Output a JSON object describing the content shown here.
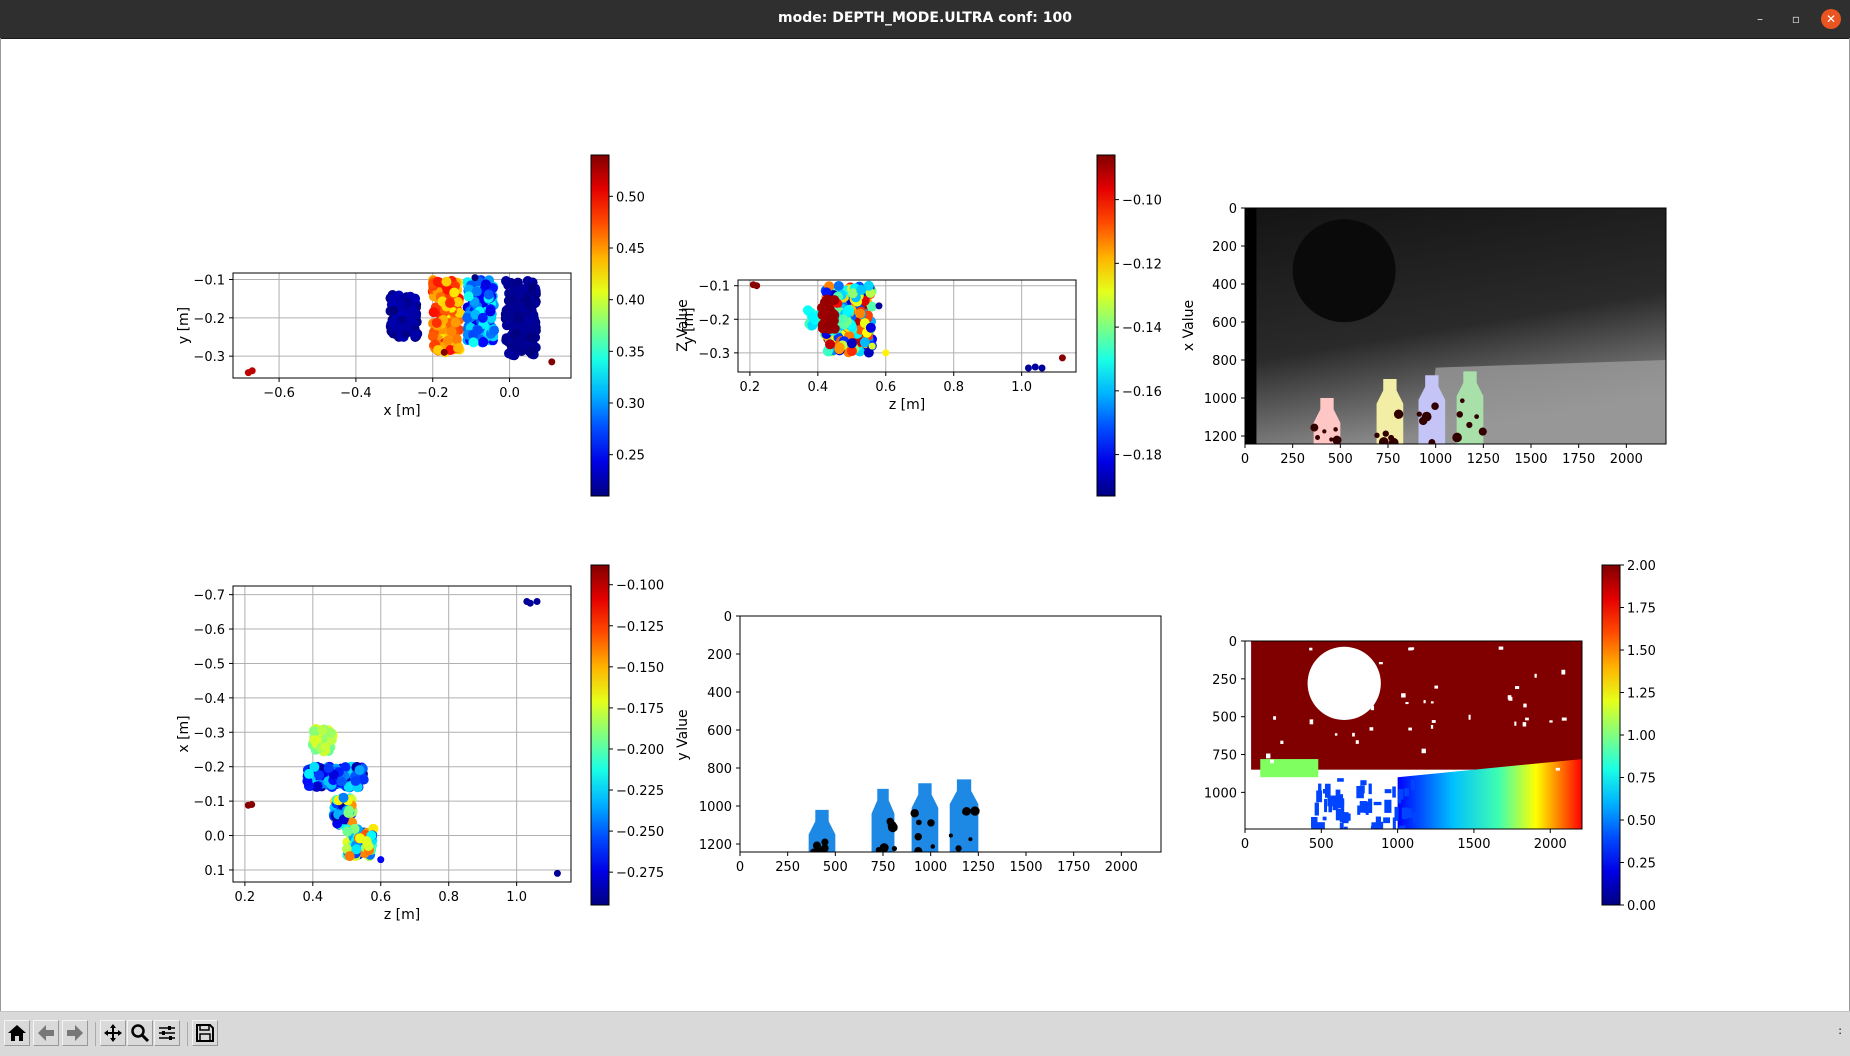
{
  "window": {
    "title": "mode: DEPTH_MODE.ULTRA conf: 100",
    "minimize": "–",
    "maximize": "▫",
    "close": "✕"
  },
  "toolbar": {
    "buttons": [
      {
        "name": "home",
        "icon": "home-icon"
      },
      {
        "name": "back",
        "icon": "arrow-left-icon"
      },
      {
        "name": "forward",
        "icon": "arrow-right-icon"
      },
      {
        "name": "pan",
        "icon": "move-icon"
      },
      {
        "name": "zoom",
        "icon": "magnifier-icon"
      },
      {
        "name": "configure-subplots",
        "icon": "sliders-icon"
      },
      {
        "name": "save",
        "icon": "floppy-icon"
      }
    ],
    "coords": ":"
  },
  "chart_data": [
    {
      "id": "p1",
      "type": "scatter",
      "xlabel": "x [m]",
      "ylabel": "y [m]",
      "cbar_label": "Z Value",
      "xlim": [
        -0.72,
        0.16
      ],
      "ylim": [
        -0.357,
        -0.083
      ],
      "xticks": [
        -0.6,
        -0.4,
        -0.2,
        0.0
      ],
      "xtick_labels": [
        "−0.6",
        "−0.4",
        "−0.2",
        "0.0"
      ],
      "yticks": [
        -0.1,
        -0.2,
        -0.3
      ],
      "ytick_labels": [
        "−0.1",
        "−0.2",
        "−0.3"
      ],
      "clim": [
        0.21,
        0.54
      ],
      "cticks": [
        0.25,
        0.3,
        0.35,
        0.4,
        0.45,
        0.5
      ],
      "ctick_labels": [
        "0.25",
        "0.30",
        "0.35",
        "0.40",
        "0.45",
        "0.50"
      ],
      "clusters": [
        {
          "x": [
            -0.31,
            -0.24
          ],
          "y": [
            -0.25,
            -0.14
          ],
          "c": [
            0.21,
            0.23
          ],
          "n": 120
        },
        {
          "x": [
            -0.2,
            -0.13
          ],
          "y": [
            -0.29,
            -0.1
          ],
          "c": [
            0.42,
            0.5
          ],
          "n": 160
        },
        {
          "x": [
            -0.11,
            -0.04
          ],
          "y": [
            -0.265,
            -0.1
          ],
          "c": [
            0.24,
            0.34
          ],
          "n": 160
        },
        {
          "x": [
            -0.01,
            0.07
          ],
          "y": [
            -0.3,
            -0.1
          ],
          "c": [
            0.21,
            0.22
          ],
          "n": 160
        }
      ],
      "points": [
        [
          -0.68,
          -0.343,
          0.52
        ],
        [
          -0.67,
          -0.338,
          0.52
        ],
        [
          0.11,
          -0.315,
          0.54
        ],
        [
          -0.09,
          -0.095,
          0.21
        ],
        [
          -0.17,
          -0.29,
          0.54
        ]
      ]
    },
    {
      "id": "p2",
      "type": "scatter",
      "xlabel": "z [m]",
      "ylabel": "y [m]",
      "cbar_label": "x Value",
      "xlim": [
        0.165,
        1.16
      ],
      "ylim": [
        -0.357,
        -0.083
      ],
      "xticks": [
        0.2,
        0.4,
        0.6,
        0.8,
        1.0
      ],
      "xtick_labels": [
        "0.2",
        "0.4",
        "0.6",
        "0.8",
        "1.0"
      ],
      "yticks": [
        -0.1,
        -0.2,
        -0.3
      ],
      "ytick_labels": [
        "−0.1",
        "−0.2",
        "−0.3"
      ],
      "clim": [
        -0.193,
        -0.086
      ],
      "cticks": [
        -0.18,
        -0.16,
        -0.14,
        -0.12,
        -0.1
      ],
      "ctick_labels": [
        "−0.18",
        "−0.16",
        "−0.14",
        "−0.12",
        "−0.10"
      ],
      "clusters": [
        {
          "x": [
            0.42,
            0.56
          ],
          "y": [
            -0.3,
            -0.1
          ],
          "c": [
            -0.19,
            -0.09
          ],
          "n": 260
        },
        {
          "x": [
            0.37,
            0.5
          ],
          "y": [
            -0.22,
            -0.17
          ],
          "c": [
            -0.16,
            -0.14
          ],
          "n": 60
        },
        {
          "x": [
            0.41,
            0.45
          ],
          "y": [
            -0.23,
            -0.14
          ],
          "c": [
            -0.09,
            -0.088
          ],
          "n": 40
        }
      ],
      "points": [
        [
          0.21,
          -0.097,
          -0.087
        ],
        [
          0.22,
          -0.1,
          -0.087
        ],
        [
          1.02,
          -0.345,
          -0.19
        ],
        [
          1.04,
          -0.342,
          -0.19
        ],
        [
          1.06,
          -0.345,
          -0.19
        ],
        [
          1.12,
          -0.315,
          -0.087
        ],
        [
          0.58,
          -0.16,
          -0.19
        ],
        [
          0.6,
          -0.3,
          -0.125
        ],
        [
          0.56,
          -0.28,
          -0.13
        ]
      ]
    },
    {
      "id": "p3",
      "type": "image",
      "xlim": [
        0,
        2208
      ],
      "ylim": [
        1242,
        0
      ],
      "xticks": [
        0,
        250,
        500,
        750,
        1000,
        1250,
        1500,
        1750,
        2000
      ],
      "xtick_labels": [
        "0",
        "250",
        "500",
        "750",
        "1000",
        "1250",
        "1500",
        "1750",
        "2000"
      ],
      "yticks": [
        0,
        200,
        400,
        600,
        800,
        1000,
        1200
      ],
      "ytick_labels": [
        "0",
        "200",
        "400",
        "600",
        "800",
        "1000",
        "1200"
      ],
      "objects": [
        {
          "x": [
            360,
            500
          ],
          "top": 1000,
          "color": "#ffc6c6"
        },
        {
          "x": [
            690,
            830
          ],
          "top": 900,
          "color": "#f2eea6"
        },
        {
          "x": [
            910,
            1050
          ],
          "top": 880,
          "color": "#c4c4f6"
        },
        {
          "x": [
            1110,
            1250
          ],
          "top": 860,
          "color": "#a9e0a9"
        }
      ]
    },
    {
      "id": "p4",
      "type": "scatter",
      "xlabel": "z [m]",
      "ylabel": "x [m]",
      "cbar_label": "y Value",
      "xlim": [
        0.165,
        1.16
      ],
      "ylim": [
        0.135,
        -0.725
      ],
      "xticks": [
        0.2,
        0.4,
        0.6,
        0.8,
        1.0
      ],
      "xtick_labels": [
        "0.2",
        "0.4",
        "0.6",
        "0.8",
        "1.0"
      ],
      "yticks": [
        -0.7,
        -0.6,
        -0.5,
        -0.4,
        -0.3,
        -0.2,
        -0.1,
        0.0,
        0.1
      ],
      "ytick_labels": [
        "−0.7",
        "−0.6",
        "−0.5",
        "−0.4",
        "−0.3",
        "−0.2",
        "−0.1",
        "0.0",
        "0.1"
      ],
      "clim": [
        -0.295,
        -0.088
      ],
      "cticks": [
        -0.275,
        -0.25,
        -0.225,
        -0.2,
        -0.175,
        -0.15,
        -0.125,
        -0.1
      ],
      "ctick_labels": [
        "−0.275",
        "−0.250",
        "−0.225",
        "−0.200",
        "−0.175",
        "−0.150",
        "−0.125",
        "−0.100"
      ],
      "clusters": [
        {
          "x": [
            0.4,
            0.46
          ],
          "y": [
            -0.31,
            -0.24
          ],
          "c": [
            -0.2,
            -0.17
          ],
          "n": 60
        },
        {
          "x": [
            0.38,
            0.55
          ],
          "y": [
            -0.2,
            -0.14
          ],
          "c": [
            -0.29,
            -0.22
          ],
          "n": 120
        },
        {
          "x": [
            0.46,
            0.52
          ],
          "y": [
            -0.11,
            -0.03
          ],
          "c": [
            -0.29,
            -0.14
          ],
          "n": 70
        },
        {
          "x": [
            0.5,
            0.58
          ],
          "y": [
            -0.02,
            0.06
          ],
          "c": [
            -0.27,
            -0.13
          ],
          "n": 80
        }
      ],
      "points": [
        [
          0.22,
          -0.09,
          -0.09
        ],
        [
          0.21,
          -0.088,
          -0.09
        ],
        [
          1.03,
          -0.68,
          -0.29
        ],
        [
          1.06,
          -0.68,
          -0.29
        ],
        [
          1.04,
          -0.675,
          -0.29
        ],
        [
          1.12,
          0.11,
          -0.29
        ],
        [
          0.6,
          0.07,
          -0.27
        ]
      ]
    },
    {
      "id": "p5",
      "type": "image",
      "xlim": [
        0,
        2208
      ],
      "ylim": [
        1242,
        0
      ],
      "xticks": [
        0,
        250,
        500,
        750,
        1000,
        1250,
        1500,
        1750,
        2000
      ],
      "xtick_labels": [
        "0",
        "250",
        "500",
        "750",
        "1000",
        "1250",
        "1500",
        "1750",
        "2000"
      ],
      "yticks": [
        0,
        200,
        400,
        600,
        800,
        1000,
        1200
      ],
      "ytick_labels": [
        "0",
        "200",
        "400",
        "600",
        "800",
        "1000",
        "1200"
      ],
      "objects": [
        {
          "x": [
            360,
            500
          ],
          "top": 1020,
          "color": "#1e88e5"
        },
        {
          "x": [
            690,
            810
          ],
          "top": 910,
          "color": "#1e88e5"
        },
        {
          "x": [
            900,
            1040
          ],
          "top": 880,
          "color": "#1e88e5"
        },
        {
          "x": [
            1100,
            1250
          ],
          "top": 860,
          "color": "#1e88e5"
        }
      ]
    },
    {
      "id": "p6",
      "type": "heatmap",
      "xlim": [
        0,
        2208
      ],
      "ylim": [
        1242,
        0
      ],
      "xticks": [
        0,
        500,
        1000,
        1500,
        2000
      ],
      "xtick_labels": [
        "0",
        "500",
        "1000",
        "1500",
        "2000"
      ],
      "yticks": [
        0,
        250,
        500,
        750,
        1000
      ],
      "ytick_labels": [
        "0",
        "250",
        "500",
        "750",
        "1000"
      ],
      "clim": [
        0,
        2
      ],
      "cticks": [
        0,
        0.25,
        0.5,
        0.75,
        1,
        1.25,
        1.5,
        1.75,
        2
      ],
      "ctick_labels": [
        "0.00",
        "0.25",
        "0.50",
        "0.75",
        "1.00",
        "1.25",
        "1.50",
        "1.75",
        "2.00"
      ]
    }
  ]
}
